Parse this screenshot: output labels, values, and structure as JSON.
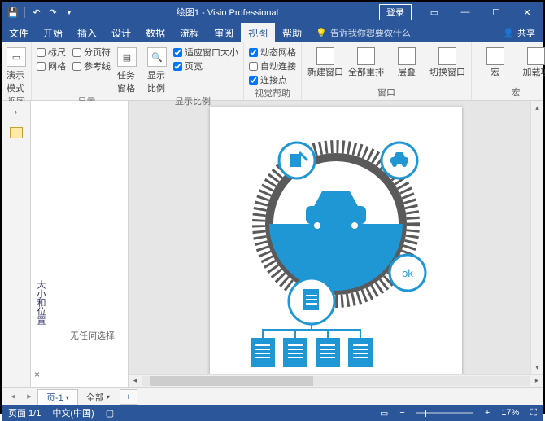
{
  "titlebar": {
    "doc_name": "绘图1",
    "app_name": "Visio Professional",
    "login": "登录"
  },
  "tabs": {
    "file": "文件",
    "home": "开始",
    "insert": "插入",
    "design": "设计",
    "data": "数据",
    "process": "流程",
    "review": "审阅",
    "view": "视图",
    "help": "帮助",
    "tell_me": "告诉我你想要做什么",
    "share": "共享"
  },
  "ribbon": {
    "presentation_mode": "演示模式",
    "group_view": "视图",
    "ruler": "标尺",
    "grid": "网格",
    "page_breaks": "分页符",
    "guides": "参考线",
    "task_panes": "任务窗格",
    "group_show": "显示",
    "show_ratio": "显示比例",
    "fit_window": "适应窗口大小",
    "page_width": "页宽",
    "group_show_ratio": "显示比例",
    "dynamic_grid": "动态网格",
    "auto_connect": "自动连接",
    "connection_points": "连接点",
    "group_visual": "视觉帮助",
    "new_window": "新建窗口",
    "arrange_all": "全部重排",
    "cascade": "层叠",
    "switch_windows": "切换窗口",
    "group_window": "窗口",
    "macros": "宏",
    "addons": "加载项",
    "group_macros": "宏"
  },
  "taskpane": {
    "title": "大小和位置",
    "no_selection": "无任何选择"
  },
  "diagram": {
    "ok_label": "ok"
  },
  "pagetabs": {
    "page1": "页-1",
    "all": "全部"
  },
  "statusbar": {
    "page_info": "页面 1/1",
    "language": "中文(中国)",
    "zoom": "17%"
  }
}
